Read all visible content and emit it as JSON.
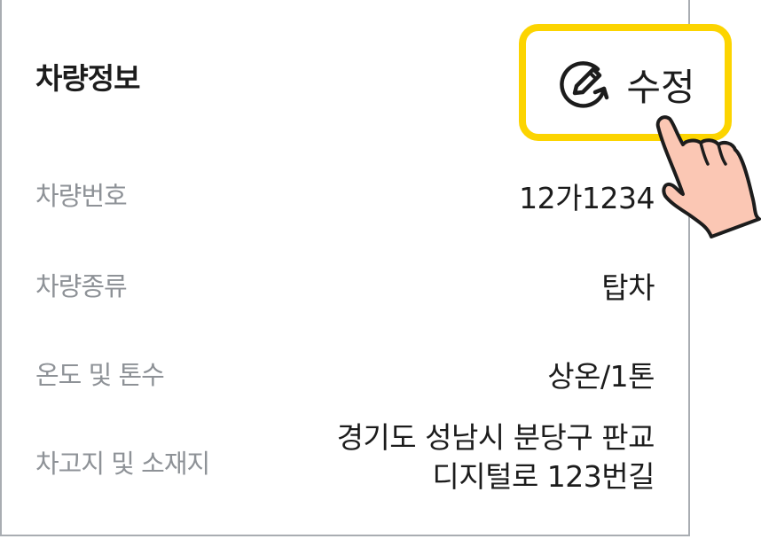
{
  "section": {
    "title": "차량정보"
  },
  "edit_button": {
    "label": "수정",
    "icon": "edit-pencil-refresh-icon",
    "highlight_color": "#fcd400"
  },
  "rows": [
    {
      "label": "차량번호",
      "value_lines": [
        "12가1234"
      ]
    },
    {
      "label": "차량종류",
      "value_lines": [
        "탑차"
      ]
    },
    {
      "label": "온도 및 톤수",
      "value_lines": [
        "상온/1톤"
      ]
    },
    {
      "label": "차고지 및 소재지",
      "value_lines": [
        "경기도 성남시 분당구 판교",
        "디지털로 123번길"
      ]
    }
  ],
  "colors": {
    "label_gray": "#8e9297",
    "text_dark": "#1c1c1c",
    "hand_skin": "#fbc7b4",
    "border": "#a9adb2"
  }
}
